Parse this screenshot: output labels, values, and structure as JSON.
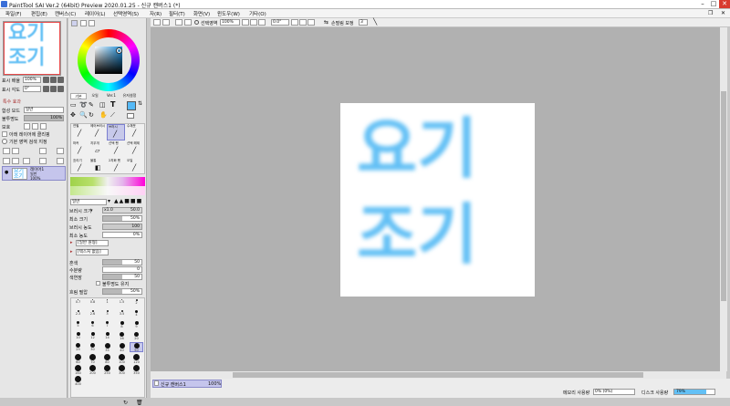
{
  "window": {
    "title": "PaintTool SAI Ver.2 (64bit) Preview 2020.01.25 - 신규 캔버스1 (*)",
    "minimize": "–",
    "maximize": "□",
    "close": "✕"
  },
  "menu": [
    "파일(F)",
    "편집(E)",
    "캔버스(C)",
    "레이어(L)",
    "선택영역(S)",
    "자(R)",
    "필터(T)",
    "화면(V)",
    "윈도우(W)",
    "기타(O)"
  ],
  "toolbar": {
    "selection_label": "선택영역",
    "zoom": "100%",
    "angle": "0.0°",
    "stabilizer_label": "손떨림 보정",
    "stabilizer_value": "3"
  },
  "navigator": {
    "zoom_label": "표시 배율",
    "zoom_value": "100%",
    "angle_label": "표시 각도",
    "angle_value": "0°"
  },
  "canvas_text": {
    "line1": "요기",
    "line2": "조기"
  },
  "layer_panel": {
    "section_title": "특수 효과",
    "blend_label": "합성 모드",
    "blend_value": "일반",
    "opacity_label": "불투명도",
    "opacity_value": "100%",
    "protect_label": "보호",
    "clip_label": "아래 레이어에 클리핑",
    "ref_label": "기본 영역 검색 지정",
    "layer_name": "레이어1",
    "layer_mode": "일반",
    "layer_opacity": "100%"
  },
  "color_panel": {
    "tabs": [
      "기본",
      "오일",
      "Ver.1",
      "유저설정"
    ]
  },
  "tools": {
    "row1": [
      "연필",
      "에어브러시",
      "브러시",
      "수채붓"
    ],
    "row2": [
      "마커",
      "지우개",
      "선택 펜",
      "선택 해제"
    ],
    "row3": [
      "흐리기",
      "물통",
      "2치화 펜",
      "오일"
    ]
  },
  "brush_settings": {
    "mode": "일반",
    "size_label": "브러시 크기",
    "size_mult": "x1.0",
    "size_value": "50.0",
    "min_size_label": "최소 크기",
    "min_size_value": "50%",
    "density_label": "브러시 농도",
    "density_value": "100",
    "min_density_label": "최소 농도",
    "min_density_value": "0%",
    "shape_label": "[일반 원형]",
    "texture_label": "[텍스처 없음]",
    "mix_label": "혼색",
    "water_label": "수분량",
    "color_stretch_label": "색연장",
    "mix_value": "50",
    "water_value": "0",
    "stretch_value": "50",
    "keep_opacity_label": "불투명도 유지",
    "blur_label": "흐림 필압",
    "blur_value": "50%"
  },
  "brush_sizes": [
    "0.7",
    "0.8",
    "1",
    "1.5",
    "2",
    "2.3",
    "2.6",
    "3",
    "3.5",
    "4",
    "5",
    "6",
    "7",
    "8",
    "9",
    "10",
    "12",
    "14",
    "16",
    "20",
    "25",
    "30",
    "35",
    "40",
    "50",
    "60",
    "70",
    "80",
    "100",
    "120",
    "160",
    "200",
    "250",
    "300",
    "350",
    "400"
  ],
  "status": {
    "doc_tab": "신규 캔버스1",
    "doc_zoom": "100%",
    "memory_label": "메모리 사용량",
    "memory_value": "0% (0%)",
    "disk_label": "디스크 사용량",
    "disk_value": "79%",
    "disk_fraction": 0.79
  },
  "colors": {
    "accent": "#63c0f5",
    "selected_tool": "#c7c9ea",
    "selected_color": "#55b9f6"
  }
}
